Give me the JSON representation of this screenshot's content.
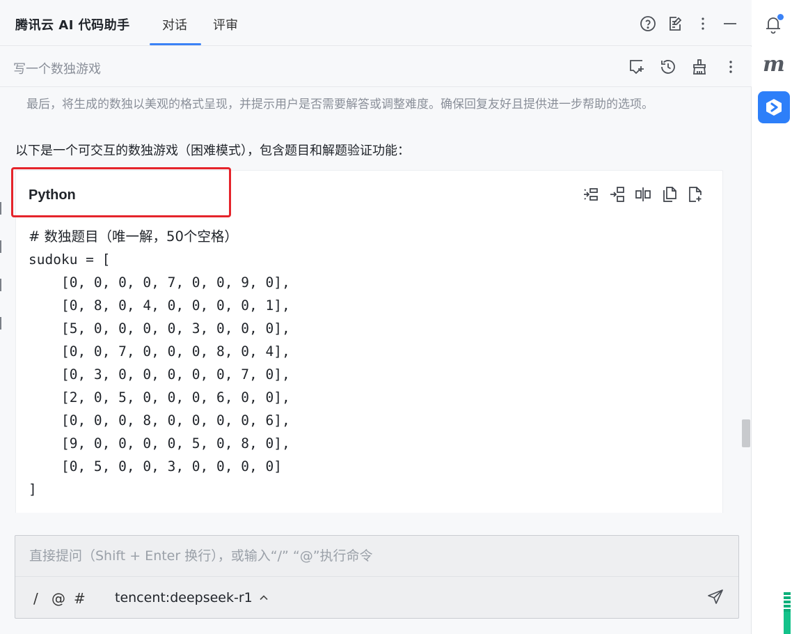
{
  "header": {
    "app_title": "腾讯云 AI 代码助手",
    "tabs": [
      {
        "label": "对话",
        "active": true
      },
      {
        "label": "评审",
        "active": false
      }
    ],
    "icons": [
      "help-icon",
      "edit-note-icon",
      "more-vertical-icon",
      "minimize-icon"
    ]
  },
  "subheader": {
    "conversation_title": "写一个数独游戏",
    "icons": [
      "new-chat-icon",
      "history-icon",
      "clean-icon",
      "more-vertical-icon"
    ]
  },
  "chat": {
    "thinking_text": "最后，将生成的数独以美观的格式呈现，并提示用户是否需要解答或调整难度。确保回复友好且提供进一步帮助的选项。",
    "answer_intro": "以下是一个可交互的数独游戏（困难模式），包含题目和解题验证功能：",
    "code_block": {
      "language": "Python",
      "toolbar": [
        "insert-at-cursor-icon",
        "insert-new-line-icon",
        "diff-icon",
        "copy-icon",
        "new-file-icon"
      ],
      "lines": [
        "# 数独题目（唯一解，50个空格）",
        "sudoku = [",
        "    [0, 0, 0, 0, 7, 0, 0, 9, 0],",
        "    [0, 8, 0, 4, 0, 0, 0, 0, 1],",
        "    [5, 0, 0, 0, 0, 3, 0, 0, 0],",
        "    [0, 0, 7, 0, 0, 0, 8, 0, 4],",
        "    [0, 3, 0, 0, 0, 0, 0, 7, 0],",
        "    [2, 0, 5, 0, 0, 0, 6, 0, 0],",
        "    [0, 0, 0, 8, 0, 0, 0, 0, 6],",
        "    [9, 0, 0, 0, 0, 5, 0, 8, 0],",
        "    [0, 5, 0, 0, 3, 0, 0, 0, 0]",
        "]"
      ]
    }
  },
  "input": {
    "placeholder": "直接提问（Shift + Enter 换行），或输入“/” “@”执行命令",
    "value": "",
    "tools": [
      "/",
      "@",
      "#"
    ],
    "model": "tencent:deepseek-r1"
  },
  "colors": {
    "accent": "#3b82f6",
    "highlight": "#e5242b",
    "sidebar_app": "#2d7ff9"
  }
}
